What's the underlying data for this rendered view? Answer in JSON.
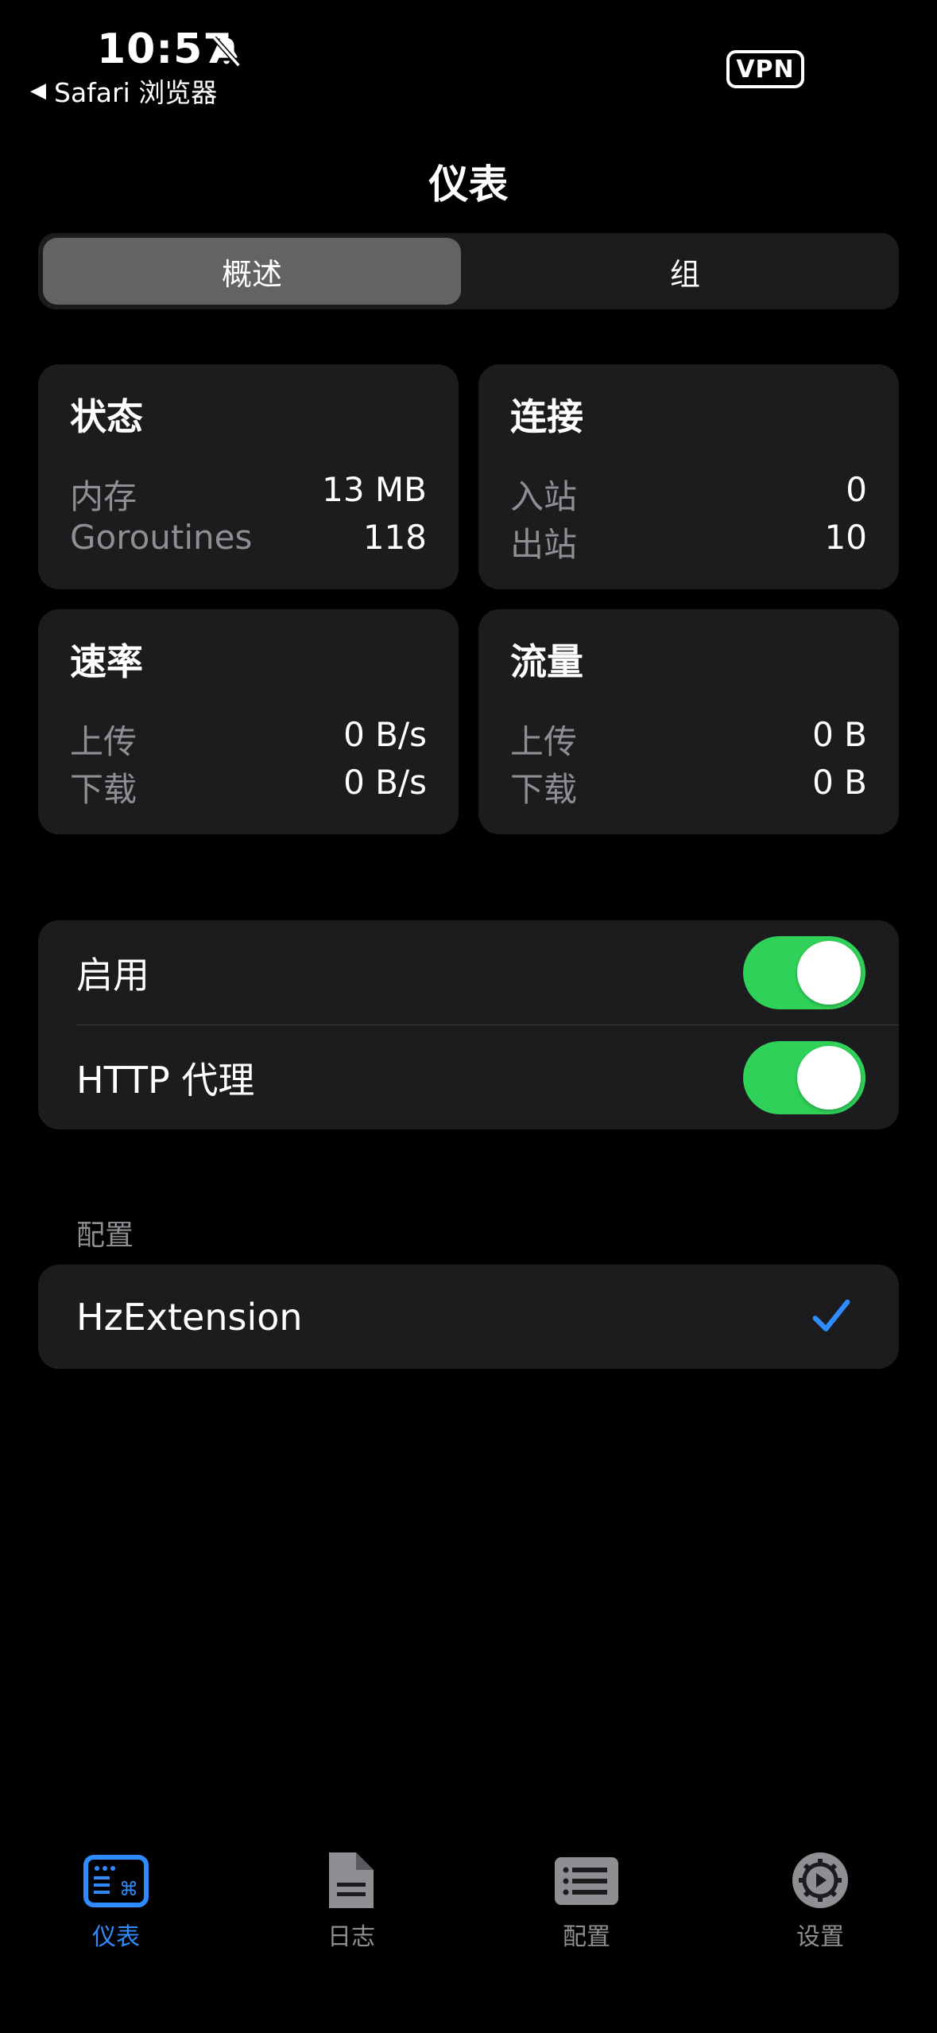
{
  "status_bar": {
    "time": "10:57",
    "back_app": "Safari 浏览器",
    "vpn": "VPN"
  },
  "title": "仪表",
  "segments": {
    "selected": "概述",
    "other": "组"
  },
  "cards": {
    "status": {
      "title": "状态",
      "row1_key": "内存",
      "row1_val": "13 MB",
      "row2_key": "Goroutines",
      "row2_val": "118"
    },
    "connections": {
      "title": "连接",
      "row1_key": "入站",
      "row1_val": "0",
      "row2_key": "出站",
      "row2_val": "10"
    },
    "rate": {
      "title": "速率",
      "row1_key": "上传",
      "row1_val": "0 B/s",
      "row2_key": "下载",
      "row2_val": "0 B/s"
    },
    "traffic": {
      "title": "流量",
      "row1_key": "上传",
      "row1_val": "0 B",
      "row2_key": "下载",
      "row2_val": "0 B"
    }
  },
  "toggles": {
    "enable": {
      "label": "启用",
      "on": true
    },
    "http_proxy": {
      "label": "HTTP 代理",
      "on": true
    }
  },
  "profiles": {
    "header": "配置",
    "selected_profile": "HzExtension"
  },
  "tabs": [
    {
      "label": "仪表",
      "icon": "dashboard-icon",
      "active": true
    },
    {
      "label": "日志",
      "icon": "document-icon",
      "active": false
    },
    {
      "label": "配置",
      "icon": "list-icon",
      "active": false
    },
    {
      "label": "设置",
      "icon": "gear-icon",
      "active": false
    }
  ],
  "colors": {
    "accent": "#2f8cff",
    "toggle_on": "#30d158",
    "card_bg": "#1c1c1e",
    "secondary_text": "#8e8e93"
  }
}
